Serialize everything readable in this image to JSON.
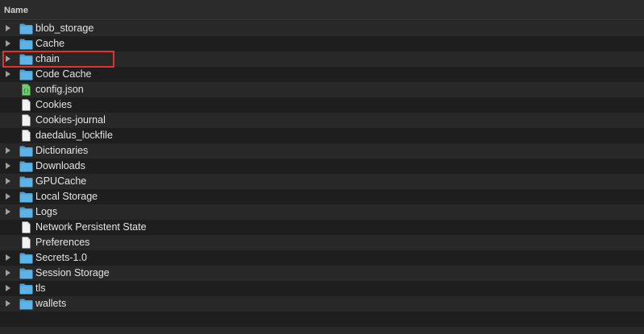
{
  "header": {
    "name_label": "Name"
  },
  "items": [
    {
      "label": "blob_storage",
      "kind": "folder",
      "expandable": true
    },
    {
      "label": "Cache",
      "kind": "folder",
      "expandable": true
    },
    {
      "label": "chain",
      "kind": "folder",
      "expandable": true,
      "highlighted": true
    },
    {
      "label": "Code Cache",
      "kind": "folder",
      "expandable": true
    },
    {
      "label": "config.json",
      "kind": "json-file",
      "expandable": false
    },
    {
      "label": "Cookies",
      "kind": "file",
      "expandable": false
    },
    {
      "label": "Cookies-journal",
      "kind": "file",
      "expandable": false
    },
    {
      "label": "daedalus_lockfile",
      "kind": "file",
      "expandable": false
    },
    {
      "label": "Dictionaries",
      "kind": "folder",
      "expandable": true
    },
    {
      "label": "Downloads",
      "kind": "folder",
      "expandable": true
    },
    {
      "label": "GPUCache",
      "kind": "folder",
      "expandable": true
    },
    {
      "label": "Local Storage",
      "kind": "folder",
      "expandable": true
    },
    {
      "label": "Logs",
      "kind": "folder",
      "expandable": true
    },
    {
      "label": "Network Persistent State",
      "kind": "file",
      "expandable": false
    },
    {
      "label": "Preferences",
      "kind": "file",
      "expandable": false
    },
    {
      "label": "Secrets-1.0",
      "kind": "folder",
      "expandable": true
    },
    {
      "label": "Session Storage",
      "kind": "folder",
      "expandable": true
    },
    {
      "label": "tls",
      "kind": "folder",
      "expandable": true
    },
    {
      "label": "wallets",
      "kind": "folder",
      "expandable": true
    }
  ],
  "colors": {
    "folder": "#5bb3e6",
    "folder_tab": "#4a9fd3",
    "file": "#f2f2f2",
    "json_file": "#6fcf6f",
    "highlight": "#e8302a"
  }
}
